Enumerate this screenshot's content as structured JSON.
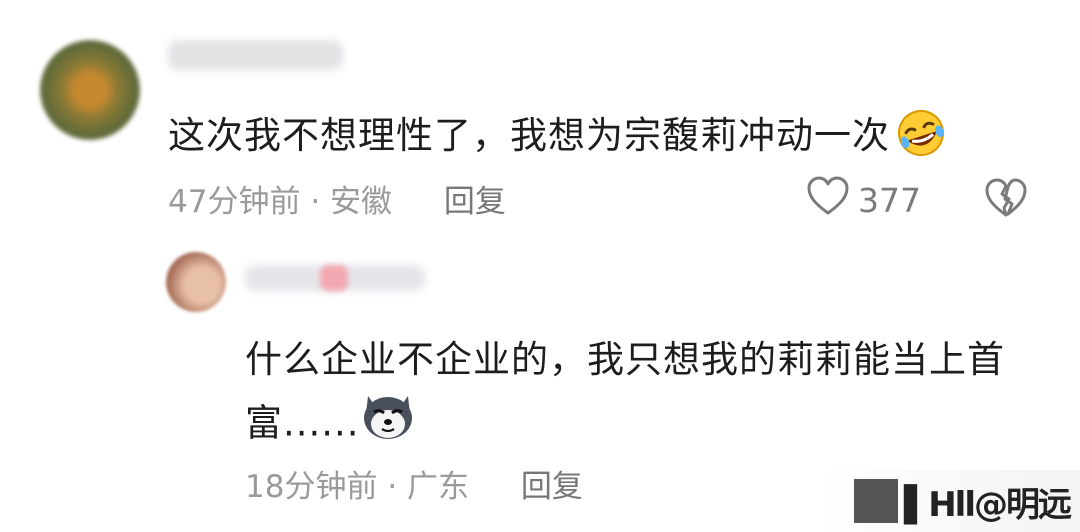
{
  "comments": [
    {
      "text": "这次我不想理性了，我想为宗馥莉冲动一次",
      "time": "47分钟前",
      "separator": "·",
      "location": "安徽",
      "reply_label": "回复",
      "likes": "377",
      "emoji": "rolling-on-floor-laughing"
    },
    {
      "text": "什么企业不企业的，我只想我的莉莉能当上首富......",
      "time": "18分钟前",
      "separator": "·",
      "location": "广东",
      "reply_label": "回复",
      "emoji": "husky-dog"
    }
  ],
  "colors": {
    "meta_text": "#9a9a9a",
    "body_text": "#1d1d1d",
    "background": "#ffffff"
  },
  "watermark": "▌Hll@明远"
}
